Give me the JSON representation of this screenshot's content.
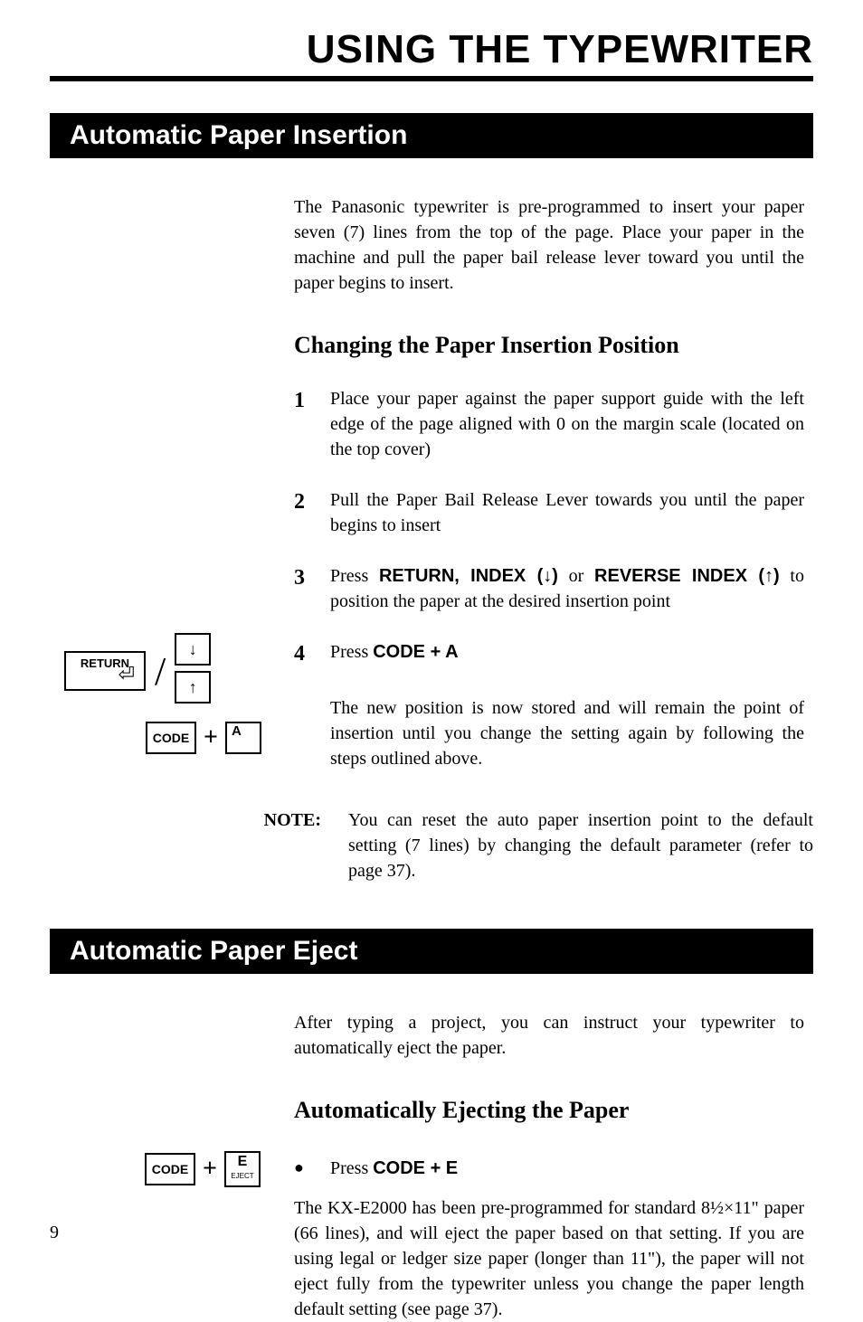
{
  "page_title": "USING THE TYPEWRITER",
  "section1": {
    "title": "Automatic Paper Insertion",
    "intro": "The Panasonic typewriter is pre-programmed to insert your paper seven (7) lines from the top of the page. Place your paper in the machine and pull the paper bail release lever toward you until the paper begins to insert.",
    "sub_heading": "Changing the Paper Insertion Position",
    "steps": [
      "Place your paper against the paper support guide with the left edge of the page aligned with 0 on the margin scale (located on the top cover)",
      "Pull the Paper Bail Release Lever towards you until the paper begins to insert"
    ],
    "step3_prefix": "Press ",
    "step3_keys": "RETURN, INDEX (↓)",
    "step3_or": " or ",
    "step3_keys2": "REVERSE INDEX (↑)",
    "step3_suffix": " to position the paper at the desired insertion point",
    "step4_prefix": "Press ",
    "step4_keys": "CODE + A",
    "after": "The new position is now stored and will remain the point of insertion until you change the setting again by following the steps outlined above.",
    "note_label": "NOTE:",
    "note_body": "You can reset the auto paper insertion point to the default setting (7 lines) by changing the default parameter (refer to page 37).",
    "keys": {
      "return": "RETURN",
      "return_glyph": "⏎",
      "down": "↓",
      "up": "↑",
      "code": "CODE",
      "a": "A"
    }
  },
  "section2": {
    "title": "Automatic Paper Eject",
    "intro": "After typing a project, you can instruct your typewriter to automatically eject the paper.",
    "sub_heading": "Automatically Ejecting the Paper",
    "bullet_prefix": "Press ",
    "bullet_keys": "CODE + E",
    "body": "The KX-E2000 has been pre-programmed for standard 8½×11\" paper (66 lines), and will eject the paper based on that setting. If you are using legal or ledger size paper (longer than 11\"), the paper will not eject fully from the typewriter unless you change the paper length default setting (see page 37).",
    "keys": {
      "code": "CODE",
      "e": "E",
      "eject": "EJECT"
    }
  },
  "page_number": "9"
}
